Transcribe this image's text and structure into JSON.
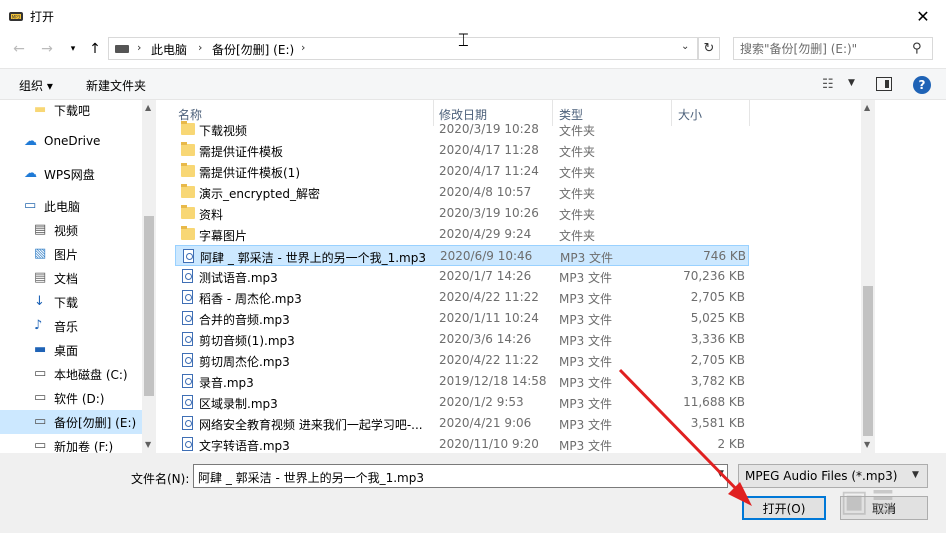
{
  "window": {
    "title": "打开"
  },
  "address": {
    "crumbs": [
      "此电脑",
      "备份[勿删] (E:)"
    ],
    "search_placeholder": "搜索\"备份[勿删] (E:)\""
  },
  "toolbar": {
    "organize": "组织 ▾",
    "new_folder": "新建文件夹"
  },
  "nav": [
    {
      "label": "下载吧",
      "icon": "folder-icon"
    },
    {
      "label": "OneDrive",
      "icon": "cloud-icon"
    },
    {
      "label": "WPS网盘",
      "icon": "cloud-icon"
    },
    {
      "label": "此电脑",
      "icon": "computer-icon"
    },
    {
      "label": "视频",
      "icon": "video-icon"
    },
    {
      "label": "图片",
      "icon": "picture-icon"
    },
    {
      "label": "文档",
      "icon": "document-icon"
    },
    {
      "label": "下载",
      "icon": "download-icon"
    },
    {
      "label": "音乐",
      "icon": "music-icon"
    },
    {
      "label": "桌面",
      "icon": "desktop-icon"
    },
    {
      "label": "本地磁盘 (C:)",
      "icon": "drive-icon"
    },
    {
      "label": "软件 (D:)",
      "icon": "drive-icon"
    },
    {
      "label": "备份[勿删] (E:)",
      "icon": "drive-icon",
      "selected": true
    },
    {
      "label": "新加卷 (F:)",
      "icon": "drive-icon"
    }
  ],
  "columns": {
    "name": "名称",
    "date": "修改日期",
    "type": "类型",
    "size": "大小"
  },
  "files": [
    {
      "name": "下载视频",
      "date": "2020/3/19 10:28",
      "type": "文件夹",
      "size": "",
      "kind": "folder"
    },
    {
      "name": "需提供证件模板",
      "date": "2020/4/17 11:28",
      "type": "文件夹",
      "size": "",
      "kind": "folder"
    },
    {
      "name": "需提供证件模板(1)",
      "date": "2020/4/17 11:24",
      "type": "文件夹",
      "size": "",
      "kind": "folder"
    },
    {
      "name": "演示_encrypted_解密",
      "date": "2020/4/8 10:57",
      "type": "文件夹",
      "size": "",
      "kind": "folder"
    },
    {
      "name": "资料",
      "date": "2020/3/19 10:26",
      "type": "文件夹",
      "size": "",
      "kind": "folder"
    },
    {
      "name": "字幕图片",
      "date": "2020/4/29 9:24",
      "type": "文件夹",
      "size": "",
      "kind": "folder"
    },
    {
      "name": "阿肆 _ 郭采洁 - 世界上的另一个我_1.mp3",
      "date": "2020/6/9 10:46",
      "type": "MP3 文件",
      "size": "746 KB",
      "kind": "mp3",
      "selected": true
    },
    {
      "name": "测试语音.mp3",
      "date": "2020/1/7 14:26",
      "type": "MP3 文件",
      "size": "70,236 KB",
      "kind": "mp3"
    },
    {
      "name": "稻香 - 周杰伦.mp3",
      "date": "2020/4/22 11:22",
      "type": "MP3 文件",
      "size": "2,705 KB",
      "kind": "mp3"
    },
    {
      "name": "合并的音频.mp3",
      "date": "2020/1/11 10:24",
      "type": "MP3 文件",
      "size": "5,025 KB",
      "kind": "mp3"
    },
    {
      "name": "剪切音频(1).mp3",
      "date": "2020/3/6 14:26",
      "type": "MP3 文件",
      "size": "3,336 KB",
      "kind": "mp3"
    },
    {
      "name": "剪切周杰伦.mp3",
      "date": "2020/4/22 11:22",
      "type": "MP3 文件",
      "size": "2,705 KB",
      "kind": "mp3"
    },
    {
      "name": "录音.mp3",
      "date": "2019/12/18 14:58",
      "type": "MP3 文件",
      "size": "3,782 KB",
      "kind": "mp3"
    },
    {
      "name": "区域录制.mp3",
      "date": "2020/1/2 9:53",
      "type": "MP3 文件",
      "size": "11,688 KB",
      "kind": "mp3"
    },
    {
      "name": "网络安全教育视频 进来我们一起学习吧-...",
      "date": "2020/4/21 9:06",
      "type": "MP3 文件",
      "size": "3,581 KB",
      "kind": "mp3"
    },
    {
      "name": "文字转语音.mp3",
      "date": "2020/11/10 9:20",
      "type": "MP3 文件",
      "size": "2 KB",
      "kind": "mp3"
    }
  ],
  "footer": {
    "filename_label": "文件名(N):",
    "filename_value": "阿肆 _ 郭采洁 - 世界上的另一个我_1.mp3",
    "filetype_value": "MPEG Audio Files (*.mp3)",
    "open_label": "打开(O)",
    "cancel_label": "取消"
  },
  "colors": {
    "selection": "#cce8ff",
    "accent": "#0078d7",
    "arrow": "#e02020"
  }
}
